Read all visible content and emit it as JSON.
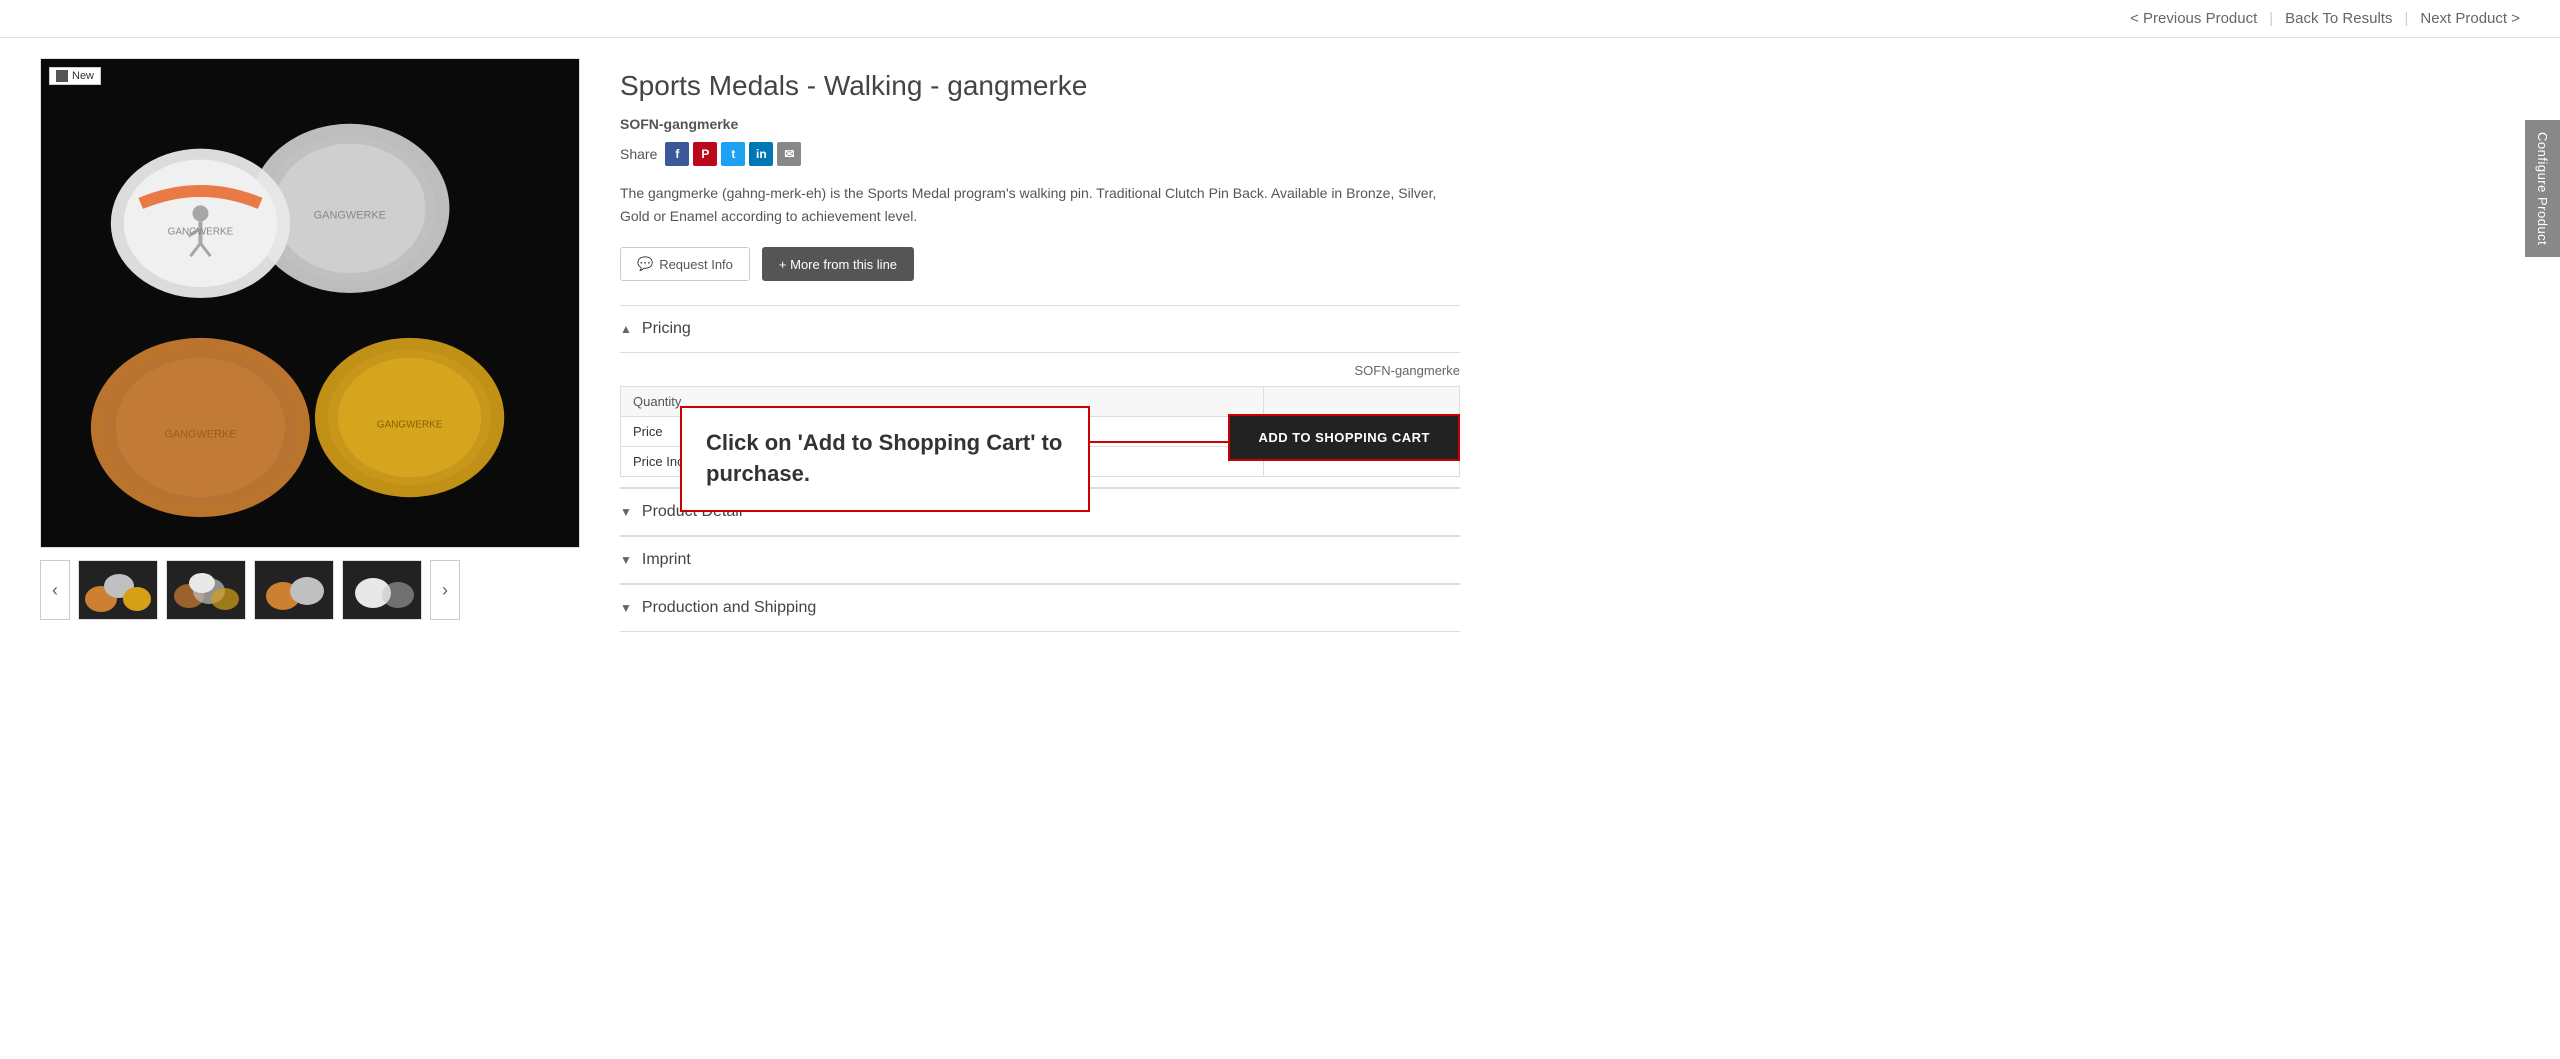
{
  "nav": {
    "previous_label": "< Previous Product",
    "back_label": "Back To Results",
    "next_label": "Next Product >"
  },
  "product": {
    "title": "Sports Medals - Walking - gangmerke",
    "sku": "SOFN-gangmerke",
    "share_label": "Share",
    "description": "The gangmerke (gahng-merk-eh) is the Sports Medal program's walking pin. Traditional Clutch Pin Back. Available in Bronze, Silver, Gold or Enamel according to achievement level.",
    "request_info_label": "Request Info",
    "more_from_line_label": "+ More from this line",
    "new_badge": "New"
  },
  "pricing": {
    "section_label": "Pricing",
    "sku_label": "SOFN-gangmerke",
    "table": {
      "headers": [
        "Quantity",
        ""
      ],
      "rows": [
        [
          "Price",
          ""
        ],
        [
          "Price Incl.",
          ""
        ]
      ]
    }
  },
  "callout": {
    "text": "Click on 'Add to Shopping Cart' to purchase."
  },
  "cart": {
    "add_label": "ADD TO SHOPPING CART"
  },
  "sections": [
    {
      "label": "Product Detail"
    },
    {
      "label": "Imprint"
    },
    {
      "label": "Production and Shipping"
    }
  ],
  "configure_btn": "Configure Product",
  "thumbnails": [
    "thumb1",
    "thumb2",
    "thumb3",
    "thumb4"
  ],
  "arrows": {
    "prev": "‹",
    "next": "›"
  }
}
